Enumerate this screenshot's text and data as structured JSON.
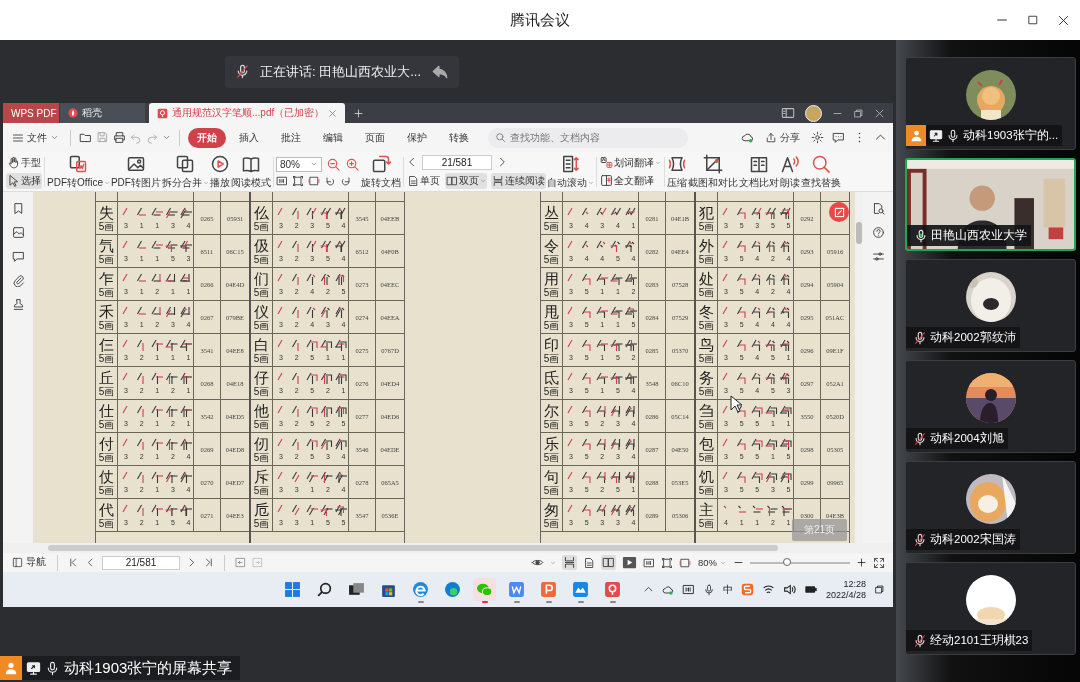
{
  "window": {
    "title": "腾讯会议"
  },
  "speaker_banner": {
    "label": "正在讲话: 田艳山西农业大..."
  },
  "shared_screen": {
    "tabs": [
      {
        "label": "WPS PDF",
        "kind": "brand",
        "selected": false
      },
      {
        "label": "稻壳",
        "kind": "app",
        "selected": false
      },
      {
        "label": "通用规范汉字笔顺...pdf（已加密）",
        "kind": "doc",
        "selected": true
      }
    ],
    "file_menu": "文件",
    "menu_tabs": [
      {
        "label": "开始",
        "selected": true
      },
      {
        "label": "插入",
        "selected": false
      },
      {
        "label": "批注",
        "selected": false
      },
      {
        "label": "编辑",
        "selected": false
      },
      {
        "label": "页面",
        "selected": false
      },
      {
        "label": "保护",
        "selected": false
      },
      {
        "label": "转换",
        "selected": false
      }
    ],
    "search": {
      "placeholder": "查找功能、文档内容"
    },
    "share": "分享",
    "ribbon": [
      {
        "kind": "stack",
        "items": [
          {
            "label": "手型",
            "selected": false,
            "dropdown": false
          },
          {
            "label": "选择",
            "selected": true,
            "dropdown": false
          }
        ]
      },
      {
        "kind": "big",
        "label": "PDF转Office",
        "dropdown": true
      },
      {
        "kind": "big",
        "label": "PDF转图片",
        "dropdown": false
      },
      {
        "kind": "big",
        "label": "拆分合并",
        "dropdown": true
      },
      {
        "kind": "big",
        "label": "播放",
        "dropdown": false
      },
      {
        "kind": "big",
        "label": "阅读模式",
        "dropdown": false
      },
      {
        "kind": "zoom",
        "value": "80%"
      },
      {
        "kind": "big",
        "label": "旋转文档",
        "dropdown": false
      },
      {
        "kind": "pager",
        "page": "21/581",
        "views": [
          {
            "label": "单页",
            "selected": false,
            "dropdown": false
          },
          {
            "label": "双页",
            "selected": true,
            "dropdown": true
          },
          {
            "label": "连续阅读",
            "selected": true,
            "dropdown": false
          }
        ]
      },
      {
        "kind": "big",
        "label": "自动滚动",
        "dropdown": true
      },
      {
        "kind": "stack",
        "items": [
          {
            "label": "划词翻译",
            "selected": false,
            "dropdown": true
          },
          {
            "label": "全文翻译",
            "selected": false,
            "dropdown": false
          }
        ]
      },
      {
        "kind": "big",
        "label": "压缩",
        "dropdown": false
      },
      {
        "kind": "big",
        "label": "截图和对比",
        "dropdown": false
      },
      {
        "kind": "big",
        "label": "文档比对",
        "dropdown": false
      },
      {
        "kind": "big",
        "label": "朗读",
        "dropdown": false
      },
      {
        "kind": "big",
        "label": "查找替换",
        "dropdown": false
      }
    ],
    "document": {
      "page_badge": "第21页",
      "tables": [
        [
          {
            "char": "失",
            "count": "5画",
            "strokes": "3 1 1 3 4",
            "code": "0265",
            "unicode": "05931"
          },
          {
            "char": "氕",
            "count": "5画",
            "strokes": "3 1 1 5 3",
            "code": "6511",
            "unicode": "06C15"
          },
          {
            "char": "乍",
            "count": "5画",
            "strokes": "3 1 2 1 1",
            "code": "0266",
            "unicode": "04E4D"
          },
          {
            "char": "禾",
            "count": "5画",
            "strokes": "3 1 2 3 4",
            "code": "0267",
            "unicode": "079BE"
          },
          {
            "char": "仨",
            "count": "5画",
            "strokes": "3 2 1 1 1",
            "code": "3541",
            "unicode": "04EE8"
          },
          {
            "char": "丘",
            "count": "5画",
            "strokes": "3 2 1 2 1",
            "code": "0268",
            "unicode": "04E18"
          },
          {
            "char": "仕",
            "count": "5画",
            "strokes": "3 2 1 2 1",
            "code": "3542",
            "unicode": "04ED5"
          },
          {
            "char": "付",
            "count": "5画",
            "strokes": "3 2 1 2 4",
            "code": "0269",
            "unicode": "04ED8"
          },
          {
            "char": "仗",
            "count": "5画",
            "strokes": "3 2 1 3 4",
            "code": "0270",
            "unicode": "04ED7"
          },
          {
            "char": "代",
            "count": "5画",
            "strokes": "3 2 1 5 4",
            "code": "0271",
            "unicode": "04EE3"
          }
        ],
        [
          {
            "char": "仫",
            "count": "5画",
            "strokes": "3 2 3 5 4",
            "code": "3545",
            "unicode": "04EEB"
          },
          {
            "char": "伋",
            "count": "5画",
            "strokes": "3 2 3 5 4",
            "code": "6512",
            "unicode": "04F0B"
          },
          {
            "char": "们",
            "count": "5画",
            "strokes": "3 2 4 2 5",
            "code": "0273",
            "unicode": "04EEC"
          },
          {
            "char": "仪",
            "count": "5画",
            "strokes": "3 2 4 3 4",
            "code": "0274",
            "unicode": "04EEA"
          },
          {
            "char": "白",
            "count": "5画",
            "strokes": "3 2 5 1 1",
            "code": "0275",
            "unicode": "0767D"
          },
          {
            "char": "仔",
            "count": "5画",
            "strokes": "3 2 5 2 1",
            "code": "0276",
            "unicode": "04ED4"
          },
          {
            "char": "他",
            "count": "5画",
            "strokes": "3 2 5 2 5",
            "code": "0277",
            "unicode": "04ED6"
          },
          {
            "char": "仞",
            "count": "5画",
            "strokes": "3 2 5 3 4",
            "code": "3546",
            "unicode": "04EDE"
          },
          {
            "char": "斥",
            "count": "5画",
            "strokes": "3 3 1 2 4",
            "code": "0278",
            "unicode": "065A5"
          },
          {
            "char": "卮",
            "count": "5画",
            "strokes": "3 3 1 5 5",
            "code": "3547",
            "unicode": "0536E"
          }
        ],
        [
          {
            "char": "丛",
            "count": "5画",
            "strokes": "3 4 3 4 1",
            "code": "0281",
            "unicode": "04E1B"
          },
          {
            "char": "令",
            "count": "5画",
            "strokes": "3 4 4 5 4",
            "code": "0282",
            "unicode": "04EE4"
          },
          {
            "char": "用",
            "count": "5画",
            "strokes": "3 5 1 1 2",
            "code": "0283",
            "unicode": "07528"
          },
          {
            "char": "甩",
            "count": "5画",
            "strokes": "3 5 1 1 5",
            "code": "0284",
            "unicode": "07529"
          },
          {
            "char": "印",
            "count": "5画",
            "strokes": "3 5 1 5 2",
            "code": "0285",
            "unicode": "05370"
          },
          {
            "char": "氐",
            "count": "5画",
            "strokes": "3 5 1 5 4",
            "code": "3548",
            "unicode": "06C10"
          },
          {
            "char": "尔",
            "count": "5画",
            "strokes": "3 5 2 3 4",
            "code": "0286",
            "unicode": "05C14"
          },
          {
            "char": "乐",
            "count": "5画",
            "strokes": "3 5 2 3 4",
            "code": "0287",
            "unicode": "04E50"
          },
          {
            "char": "句",
            "count": "5画",
            "strokes": "3 5 2 5 1",
            "code": "0288",
            "unicode": "053E5"
          },
          {
            "char": "匆",
            "count": "5画",
            "strokes": "3 5 3 3 4",
            "code": "0289",
            "unicode": "05306"
          }
        ],
        [
          {
            "char": "犯",
            "count": "5画",
            "strokes": "3 5 3 5 5",
            "code": "0292"
          },
          {
            "char": "外",
            "count": "5画",
            "strokes": "3 5 4 2 4",
            "code": "0293",
            "unicode": "05916"
          },
          {
            "char": "处",
            "count": "5画",
            "strokes": "3 5 4 2 4",
            "code": "0294",
            "unicode": "05904"
          },
          {
            "char": "冬",
            "count": "5画",
            "strokes": "3 5 4 4 4",
            "code": "0295",
            "unicode": "051AC"
          },
          {
            "char": "鸟",
            "count": "5画",
            "strokes": "3 5 4 5 1",
            "code": "0296",
            "unicode": "09E1F"
          },
          {
            "char": "务",
            "count": "5画",
            "strokes": "3 5 4 5 3",
            "code": "0297",
            "unicode": "052A1"
          },
          {
            "char": "刍",
            "count": "5画",
            "strokes": "3 5 5 1 1",
            "code": "3550",
            "unicode": "0520D"
          },
          {
            "char": "包",
            "count": "5画",
            "strokes": "3 5 5 1 5",
            "code": "0298",
            "unicode": "05305"
          },
          {
            "char": "饥",
            "count": "5画",
            "strokes": "3 5 5 3 5",
            "code": "0299",
            "unicode": "09965"
          },
          {
            "char": "主",
            "count": "5画",
            "strokes": "4 1 1 2 1",
            "code": "0300",
            "unicode": "04E3B"
          }
        ]
      ]
    },
    "status_bar": {
      "nav": "导航",
      "page": "21/581",
      "zoom": "80%",
      "zoom_slider": {
        "level": 0.37
      }
    },
    "taskbar": {
      "apps": [
        {
          "running": false,
          "attention": false
        },
        {
          "running": false,
          "attention": false
        },
        {
          "running": false,
          "attention": false
        },
        {
          "running": false,
          "attention": false
        },
        {
          "running": true,
          "attention": false
        },
        {
          "running": false,
          "attention": false
        },
        {
          "running": true,
          "attention": true
        },
        {
          "running": true,
          "attention": false
        },
        {
          "running": true,
          "attention": false
        },
        {
          "running": true,
          "attention": false
        },
        {
          "running": true,
          "attention": false
        }
      ],
      "ime": "中",
      "time": "12:28",
      "date": "2022/4/28"
    }
  },
  "sharer_label": "动科1903张宁的屏幕共享",
  "participants": [
    {
      "name": "动科1903张宁的...",
      "kind": "avatar",
      "muted": false,
      "sharing": true,
      "speaking": false
    },
    {
      "name": "田艳山西农业大学",
      "kind": "video",
      "muted": false,
      "sharing": false,
      "speaking": true
    },
    {
      "name": "动科2002郭纹沛",
      "kind": "avatar",
      "muted": true,
      "sharing": false,
      "speaking": false
    },
    {
      "name": "动科2004刘旭",
      "kind": "avatar",
      "muted": true,
      "sharing": false,
      "speaking": false
    },
    {
      "name": "动科2002宋国涛",
      "kind": "avatar",
      "muted": true,
      "sharing": false,
      "speaking": false
    },
    {
      "name": "经动2101王玥棋23",
      "kind": "avatar",
      "muted": true,
      "sharing": false,
      "speaking": false
    }
  ]
}
